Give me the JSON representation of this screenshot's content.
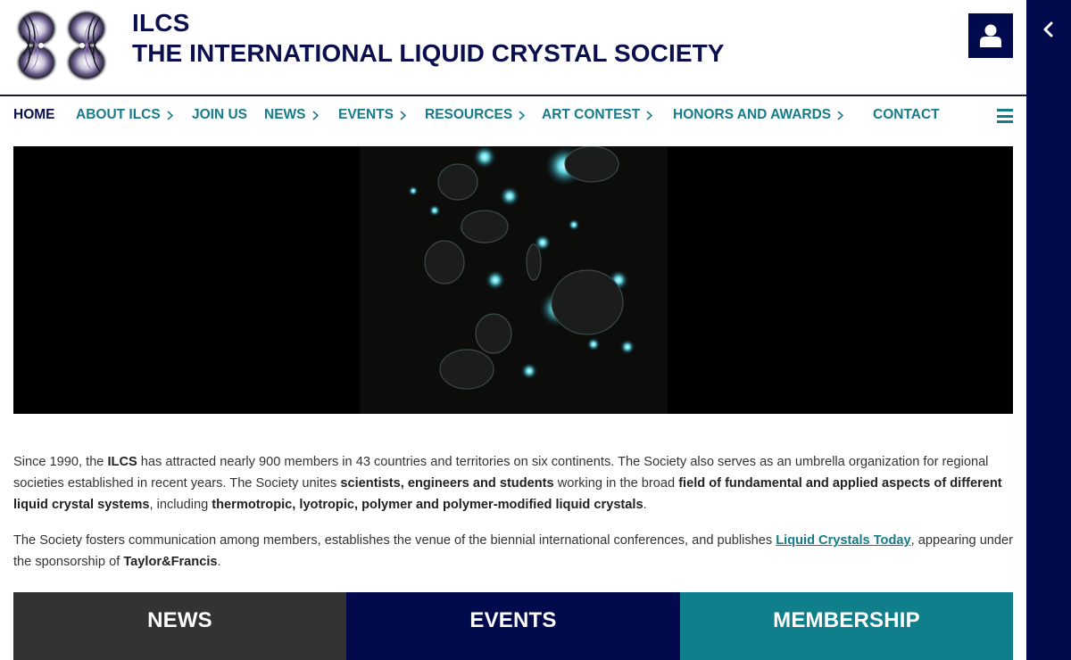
{
  "header": {
    "abbr": "ILCS",
    "name": "THE INTERNATIONAL LIQUID CRYSTAL SOCIETY",
    "logo_icon": "liquid-crystal-logo-icon",
    "user_icon": "user-icon"
  },
  "side_panel": {
    "toggle_icon": "chevron-left-icon"
  },
  "nav": {
    "home": "HOME",
    "about": "ABOUT ILCS",
    "join": "JOIN US",
    "news": "NEWS",
    "events": "EVENTS",
    "resources": "RESOURCES",
    "art": "ART CONTEST",
    "honors": "HONORS AND AWARDS",
    "contact": "CONTACT",
    "menu_icon": "hamburger-menu-icon"
  },
  "intro": {
    "p1": {
      "t1": "Since 1990, the ",
      "b1": "ILCS",
      "t2": " has attracted nearly 900 members in 43 countries and territories on six continents. The Society also serves as an umbrella organization for regional societies established in recent years. The Society unites ",
      "b2": "scientists, engineers and students",
      "t3": " working in the broad ",
      "b3": "field of fundamental and applied aspects of different liquid crystal systems",
      "t4": ", including ",
      "b4": "thermotropic, lyotropic, polymer and polymer-modified liquid crystals",
      "t5": "."
    },
    "p2": {
      "t1": "The Society fosters communication among members, establishes the venue of the biennial international conferences, and publishes ",
      "link": "Liquid Crystals Today",
      "t2": ", appearing under the sponsorship of ",
      "b1": "Taylor&Francis",
      "t3": "."
    }
  },
  "tiles": {
    "news": "NEWS",
    "events": "EVENTS",
    "membership": "MEMBERSHIP"
  },
  "colors": {
    "navy": "#000a4d",
    "teal": "#167b8a",
    "tile_news": "#333333",
    "tile_membership": "#0f7f8c"
  }
}
